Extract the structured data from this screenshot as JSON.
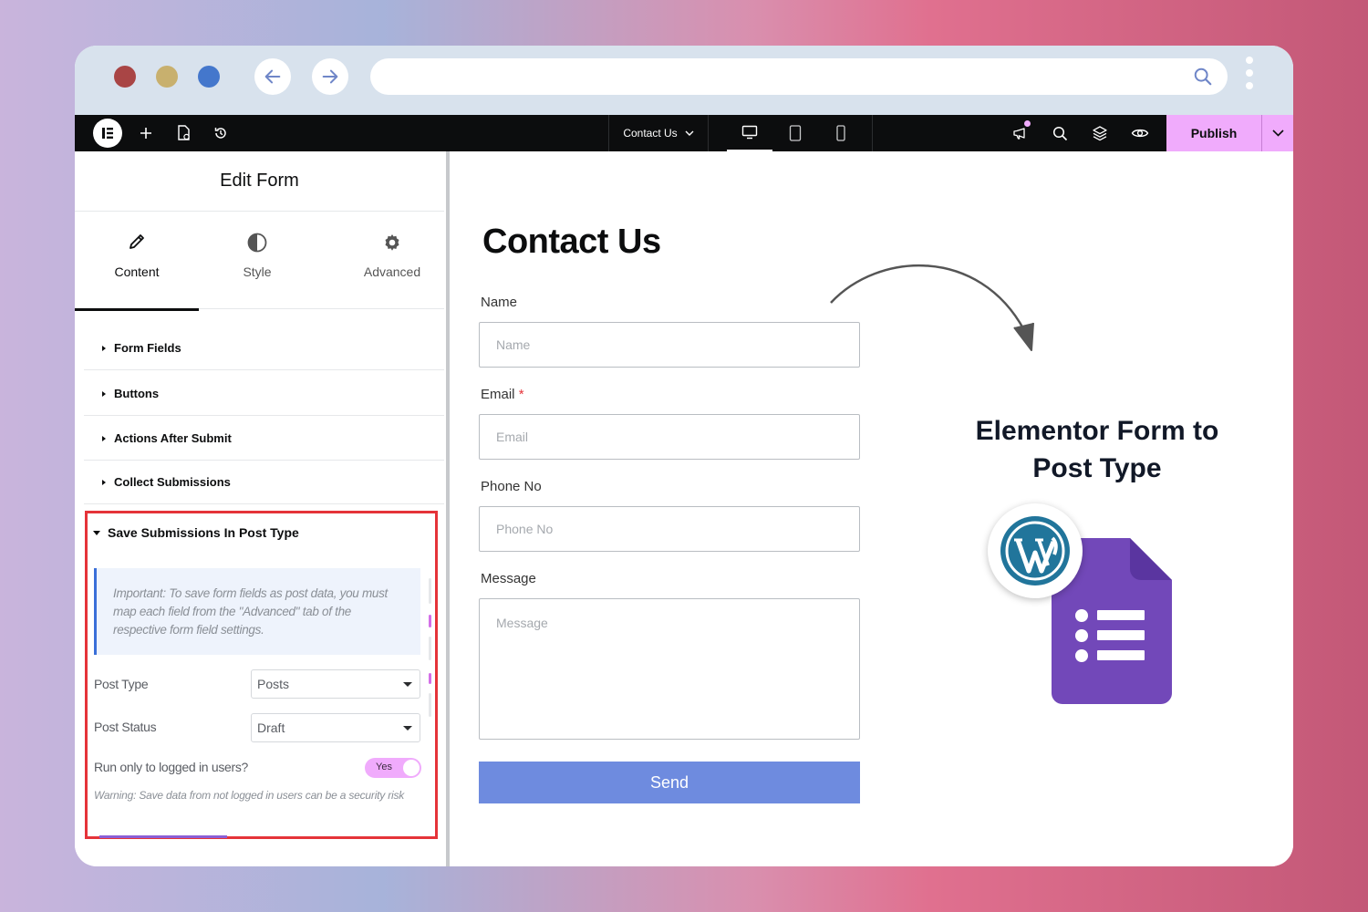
{
  "browser": {
    "url": ""
  },
  "toolbar": {
    "page_name": "Contact Us",
    "publish_label": "Publish"
  },
  "panel": {
    "title": "Edit Form",
    "tabs": [
      {
        "label": "Content",
        "icon": "pencil-icon"
      },
      {
        "label": "Style",
        "icon": "half-circle-icon"
      },
      {
        "label": "Advanced",
        "icon": "gear-icon"
      }
    ],
    "sections": [
      {
        "label": "Form Fields"
      },
      {
        "label": "Buttons"
      },
      {
        "label": "Actions After Submit"
      },
      {
        "label": "Collect Submissions"
      }
    ],
    "open_section": {
      "label": "Save Submissions In Post Type",
      "notice": "Important: To save form fields as post data, you must map each field from the \"Advanced\" tab of the respective form field settings.",
      "post_type_label": "Post Type",
      "post_type_value": "Posts",
      "post_status_label": "Post Status",
      "post_status_value": "Draft",
      "logged_in_label": "Run only to logged in users?",
      "logged_in_toggle": "Yes",
      "warning": "Warning: Save data from not logged in users can be a security risk"
    }
  },
  "canvas": {
    "heading": "Contact Us",
    "fields": [
      {
        "label": "Name",
        "placeholder": "Name",
        "required": false
      },
      {
        "label": "Email",
        "placeholder": "Email",
        "required": true
      },
      {
        "label": "Phone No",
        "placeholder": "Phone No",
        "required": false
      },
      {
        "label": "Message",
        "placeholder": "Message",
        "required": false
      }
    ],
    "required_mark": "*",
    "submit_label": "Send",
    "promo_title": "Elementor Form to Post Type"
  },
  "colors": {
    "accent_pink": "#f0abfc",
    "highlight_red": "#e53339",
    "send_button": "#6e8bdf",
    "google_forms_purple": "#7248b9",
    "wordpress_blue": "#21759b"
  }
}
